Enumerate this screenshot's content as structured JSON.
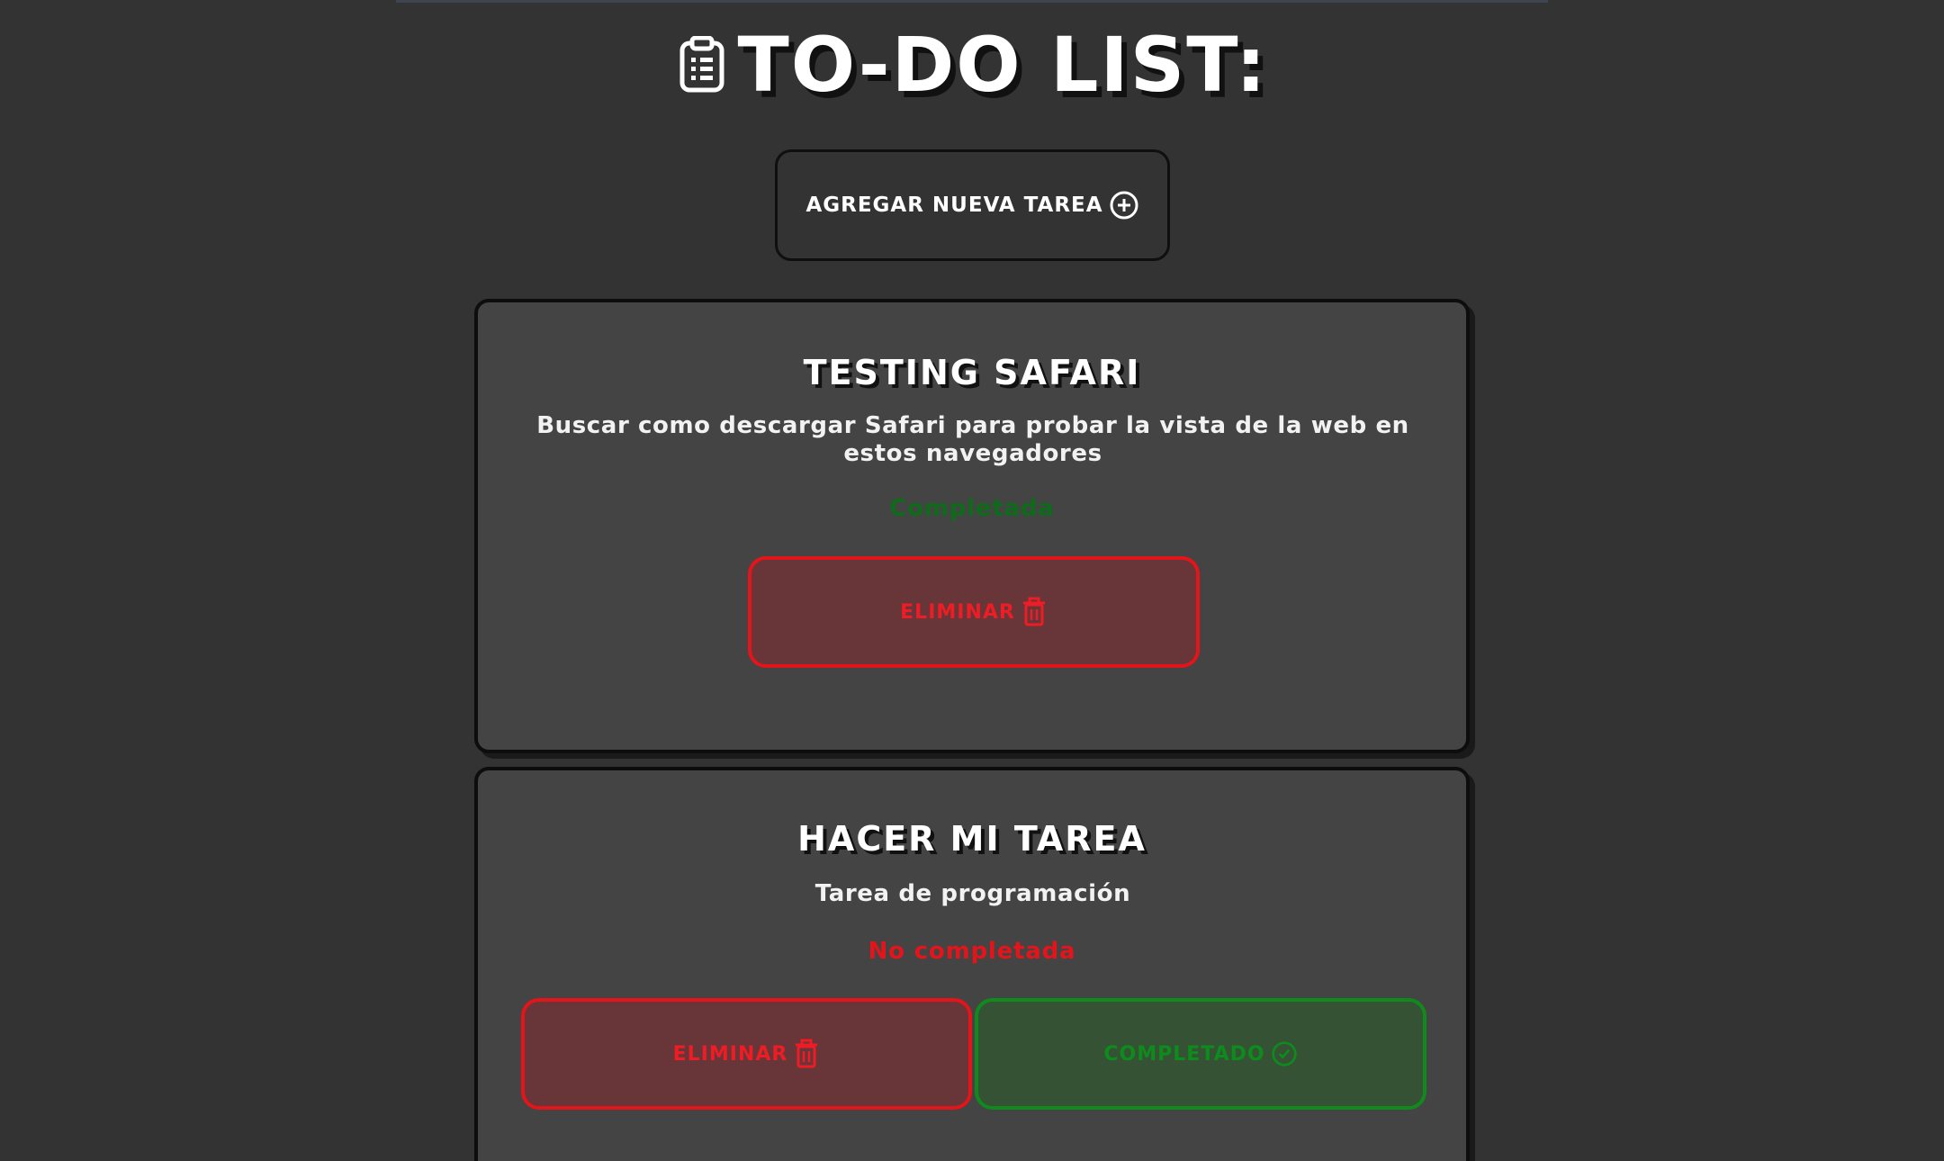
{
  "header": {
    "title": "TO-DO LIST:",
    "icon": "clipboard-icon"
  },
  "add_button": {
    "label": "AGREGAR NUEVA TAREA",
    "icon": "plus-circle-icon"
  },
  "tasks": [
    {
      "title": "TESTING SAFARI",
      "description": "Buscar como descargar Safari para probar la vista de la web en estos navegadores",
      "status": "Completada",
      "delete_label": "ELIMINAR",
      "delete_icon": "trash-icon"
    },
    {
      "title": "HACER MI TAREA",
      "description": "Tarea de programación",
      "status": "No completada",
      "delete_label": "ELIMINAR",
      "delete_icon": "trash-icon",
      "complete_label": "COMPLETADO",
      "complete_icon": "check-circle-icon"
    }
  ],
  "colors": {
    "background": "#333333",
    "card": "#444444",
    "danger": "#e3141a",
    "success": "#108a1c"
  }
}
